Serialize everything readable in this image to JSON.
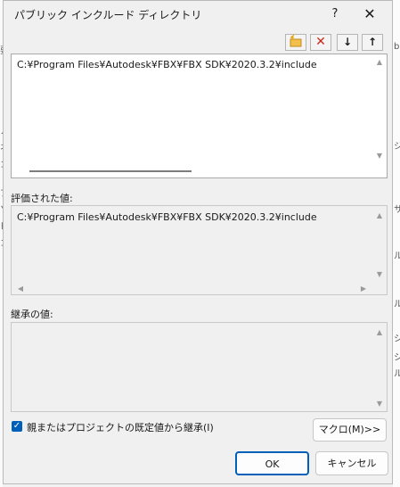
{
  "window": {
    "title": "パブリック インクルード ディレクトリ",
    "help": "?",
    "close": "✕"
  },
  "toolbar": {
    "new_line": "✦",
    "delete": "✕",
    "move_down": "↓",
    "move_up": "↑"
  },
  "editor": {
    "lines": [
      "C:¥Program Files¥Autodesk¥FBX¥FBX SDK¥2020.3.2¥include"
    ]
  },
  "evaluated": {
    "label": "評価された値:",
    "lines": [
      "C:¥Program Files¥Autodesk¥FBX¥FBX SDK¥2020.3.2¥include"
    ]
  },
  "inherited": {
    "label": "継承の値:",
    "lines": []
  },
  "inherit_checkbox": {
    "checked": true,
    "label": "親またはプロジェクトの既定値から継承(I)"
  },
  "buttons": {
    "macro": "マクロ(M)>>",
    "ok": "OK",
    "cancel": "キャンセル"
  },
  "background_fragments": {
    "left": [
      "要",
      "ノ",
      "ネ",
      "コ",
      "プ",
      "ソ",
      "ピ",
      "コ"
    ],
    "right": [
      "b",
      "ジ",
      "サ",
      "ル",
      "ル",
      "シ",
      "シ",
      "ル"
    ]
  },
  "colors": {
    "accent": "#005fb8",
    "delete_icon": "#c42b1c",
    "new_icon": "#e8a000"
  }
}
